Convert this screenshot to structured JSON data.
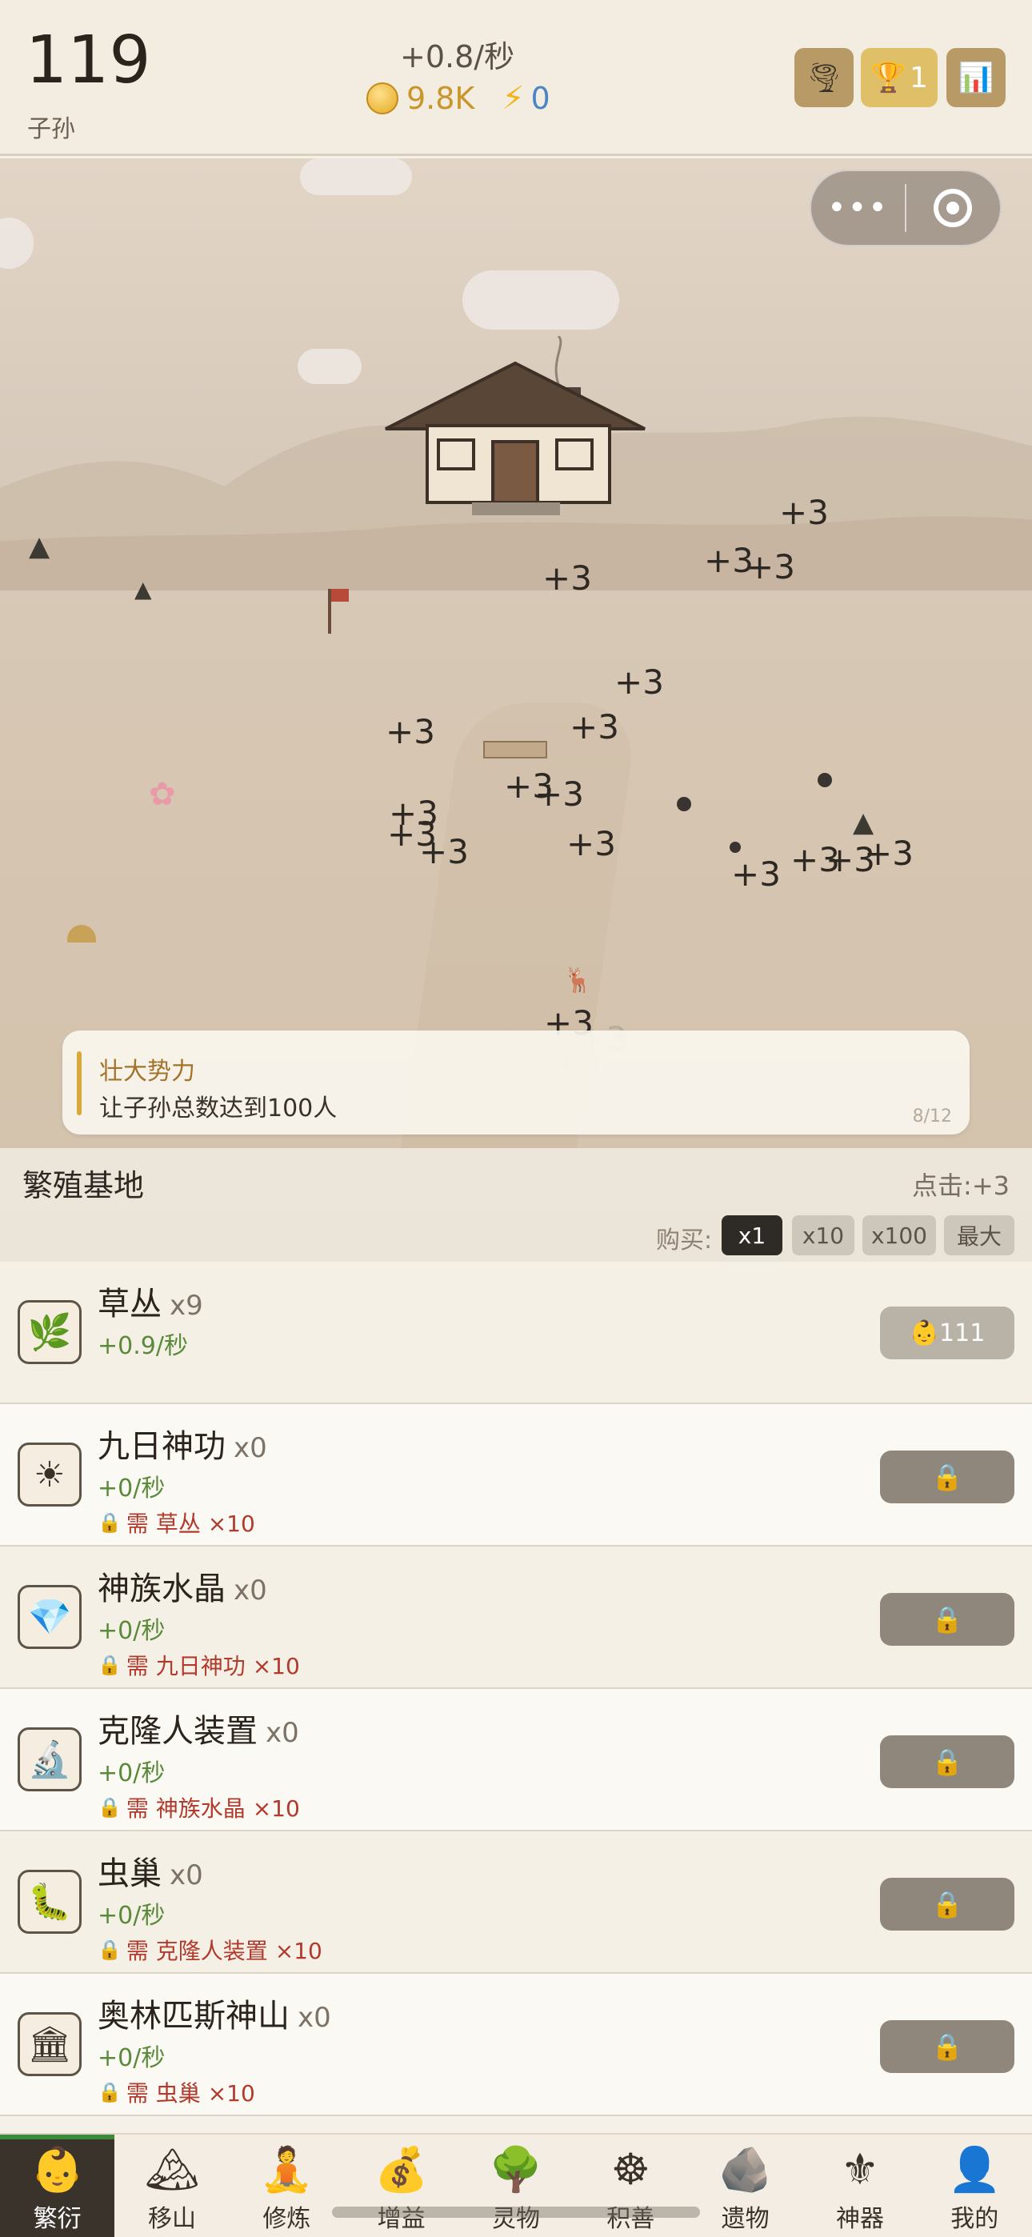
{
  "header": {
    "population": "119",
    "population_label": "子孙",
    "rate": "+0.8/秒",
    "coins": "9.8K",
    "energy": "0",
    "trophy_count": "1",
    "icons": [
      "tornado-icon",
      "trophy-icon",
      "chart-icon"
    ]
  },
  "mini_program_capsule": {
    "menu": "•••",
    "close_icon": "target-icon"
  },
  "scene": {
    "floating_gains": [
      "+3",
      "+3",
      "+3",
      "+3",
      "+3",
      "+3",
      "+3",
      "+3",
      "+3",
      "+3",
      "+3",
      "+3",
      "+3",
      "+3",
      "+3",
      "+3",
      "+3",
      "+3",
      "+3",
      "+3",
      "+3",
      "+3"
    ],
    "quest": {
      "title": "壮大势力",
      "description": "让子孙总数达到100人",
      "progress": "8/12"
    }
  },
  "section": {
    "title": "繁殖基地",
    "click_value": "点击:+3"
  },
  "buy_bar": {
    "label": "购买:",
    "options": [
      "x1",
      "x10",
      "x100",
      "最大"
    ],
    "selected": "x1"
  },
  "items": [
    {
      "name": "草丛",
      "qty": "x9",
      "rate": "+0.9/秒",
      "requirement": "",
      "button": "111",
      "icon": "herb-icon"
    },
    {
      "name": "九日神功",
      "qty": "x0",
      "rate": "+0/秒",
      "requirement": "需 草丛 ×10",
      "button": "",
      "icon": "sun-icon"
    },
    {
      "name": "神族水晶",
      "qty": "x0",
      "rate": "+0/秒",
      "requirement": "需 九日神功 ×10",
      "button": "",
      "icon": "gem-icon"
    },
    {
      "name": "克隆人装置",
      "qty": "x0",
      "rate": "+0/秒",
      "requirement": "需 神族水晶 ×10",
      "button": "",
      "icon": "microscope-icon"
    },
    {
      "name": "虫巢",
      "qty": "x0",
      "rate": "+0/秒",
      "requirement": "需 克隆人装置 ×10",
      "button": "",
      "icon": "worm-icon"
    },
    {
      "name": "奥林匹斯神山",
      "qty": "x0",
      "rate": "+0/秒",
      "requirement": "需 虫巢 ×10",
      "button": "",
      "icon": "temple-icon"
    }
  ],
  "nav": [
    {
      "label": "繁衍",
      "icon": "baby-icon",
      "active": true
    },
    {
      "label": "移山",
      "icon": "mountain-icon"
    },
    {
      "label": "修炼",
      "icon": "meditate-icon"
    },
    {
      "label": "增益",
      "icon": "money-bag-icon"
    },
    {
      "label": "灵物",
      "icon": "tree-icon"
    },
    {
      "label": "积善",
      "icon": "dharma-wheel-icon"
    },
    {
      "label": "遗物",
      "icon": "rock-icon"
    },
    {
      "label": "神器",
      "icon": "fleur-de-lis-icon"
    },
    {
      "label": "我的",
      "icon": "user-icon"
    }
  ],
  "colors": {
    "accent_gold": "#c9962b",
    "energy_blue": "#4a86c5",
    "rate_green": "#5a8a3a",
    "lock_red": "#b23a2d",
    "active_nav": "#3a332b"
  }
}
